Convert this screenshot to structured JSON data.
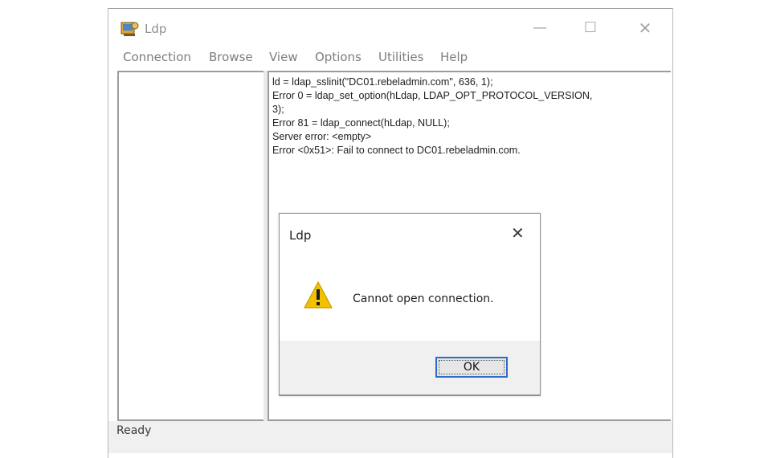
{
  "window": {
    "title": "Ldp",
    "controls": {
      "minimize": "—",
      "maximize": "☐",
      "close": "✕"
    }
  },
  "menu": {
    "items": [
      {
        "label": "Connection"
      },
      {
        "label": "Browse"
      },
      {
        "label": "View"
      },
      {
        "label": "Options"
      },
      {
        "label": "Utilities"
      },
      {
        "label": "Help"
      }
    ]
  },
  "output": {
    "lines": [
      "ld = ldap_sslinit(\"DC01.rebeladmin.com\", 636, 1);",
      "Error 0 = ldap_set_option(hLdap, LDAP_OPT_PROTOCOL_VERSION,",
      "3);",
      "Error 81 = ldap_connect(hLdap, NULL);",
      "Server error: <empty>",
      "Error <0x51>: Fail to connect to DC01.rebeladmin.com."
    ]
  },
  "status": {
    "text": "Ready"
  },
  "dialog": {
    "title": "Ldp",
    "close": "✕",
    "icon": "warning-icon",
    "message": "Cannot open connection.",
    "ok_label": "OK"
  },
  "colors": {
    "accent": "#2d6bc8",
    "warning": "#f2c200"
  }
}
